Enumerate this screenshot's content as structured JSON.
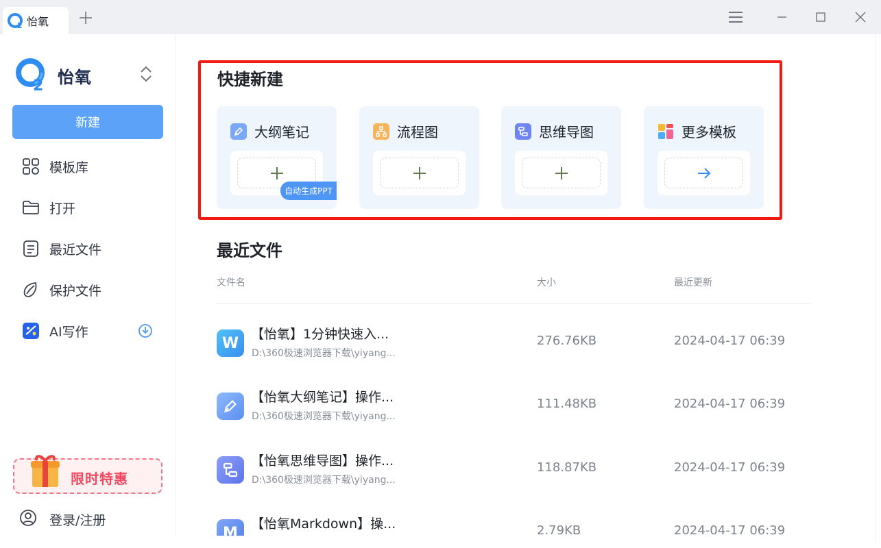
{
  "window": {
    "tab_title": "怡氧",
    "accent": "#5ba2f8"
  },
  "sidebar": {
    "brand_name": "怡氧",
    "new_button": "新建",
    "items": [
      {
        "label": "模板库",
        "icon": "grid-icon"
      },
      {
        "label": "打开",
        "icon": "folder-icon"
      },
      {
        "label": "最近文件",
        "icon": "document-list-icon"
      },
      {
        "label": "保护文件",
        "icon": "shield-leaf-icon"
      },
      {
        "label": "AI写作",
        "icon": "ai-write-icon"
      }
    ],
    "promo": "限时特惠",
    "login": "登录/注册"
  },
  "quick_create": {
    "title": "快捷新建",
    "cards": [
      {
        "label": "大纲笔记",
        "icon": "pen-icon",
        "action": "plus"
      },
      {
        "label": "流程图",
        "icon": "flowchart-icon",
        "action": "plus"
      },
      {
        "label": "思维导图",
        "icon": "mindmap-icon",
        "action": "plus"
      },
      {
        "label": "更多模板",
        "icon": "templates-icon",
        "action": "arrow"
      }
    ],
    "ppt_badge": "自动生成PPT"
  },
  "recent": {
    "title": "最近文件",
    "headers": {
      "name": "文件名",
      "size": "大小",
      "updated": "最近更新"
    },
    "files": [
      {
        "icon_letter": "W",
        "name": "【怡氧】1分钟快速入...",
        "path": "D:\\360极速浏览器下载\\yiyang...",
        "size": "276.76KB",
        "updated": "2024-04-17 06:39"
      },
      {
        "icon_letter": "",
        "name": "【怡氧大纲笔记】操作...",
        "path": "D:\\360极速浏览器下载\\yiyang...",
        "size": "111.48KB",
        "updated": "2024-04-17 06:39"
      },
      {
        "icon_letter": "",
        "name": "【怡氧思维导图】操作...",
        "path": "D:\\360极速浏览器下载\\yiyang...",
        "size": "118.87KB",
        "updated": "2024-04-17 06:39"
      },
      {
        "icon_letter": "M",
        "name": "【怡氧Markdown】操...",
        "path": "",
        "size": "2.79KB",
        "updated": "2024-04-17 06:39"
      }
    ]
  }
}
